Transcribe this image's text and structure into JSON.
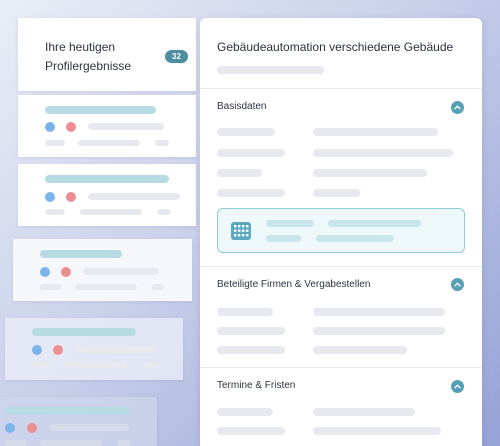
{
  "results_list": {
    "title": "Ihre heutigen Profilergebnisse",
    "count": "32"
  },
  "detail": {
    "title": "Gebäudeautomation verschiedene Gebäude",
    "sections": [
      {
        "title": "Basisdaten"
      },
      {
        "title": "Beteiligte Firmen & Vergabestellen"
      },
      {
        "title": "Termine & Fristen"
      }
    ]
  },
  "icons": {
    "collapse": "chevron-up-icon",
    "info_box": "calculator-icon",
    "result_dots": [
      "blue-dot",
      "red-dot"
    ]
  },
  "colors": {
    "accent": "#55a0b6",
    "badge": "#4e8ea2",
    "dot_blue": "#7bb4e8",
    "dot_red": "#ec8f93",
    "highlight_border": "#8fccd8",
    "skeleton": "#e7e9ee"
  }
}
